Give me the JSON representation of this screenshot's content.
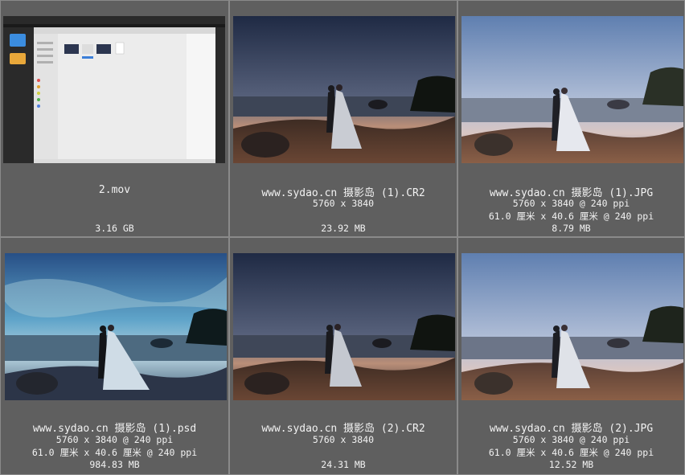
{
  "files": [
    {
      "name": "2.mov",
      "details": [],
      "size": "3.16 GB"
    },
    {
      "name": "www.sydao.cn 摄影岛 (1).CR2",
      "details": [
        "5760 x 3840"
      ],
      "size": "23.92 MB"
    },
    {
      "name": "www.sydao.cn 摄影岛 (1).JPG",
      "details": [
        "5760 x 3840 @ 240 ppi",
        "61.0 厘米 x 40.6 厘米 @ 240 ppi"
      ],
      "size": "8.79 MB"
    },
    {
      "name": "www.sydao.cn 摄影岛 (1).psd",
      "details": [
        "5760 x 3840 @ 240 ppi",
        "61.0 厘米 x 40.6 厘米 @ 240 ppi"
      ],
      "size": "984.83 MB"
    },
    {
      "name": "www.sydao.cn 摄影岛 (2).CR2",
      "details": [
        "5760 x 3840"
      ],
      "size": "24.31 MB"
    },
    {
      "name": "www.sydao.cn 摄影岛 (2).JPG",
      "details": [
        "5760 x 3840 @ 240 ppi",
        "61.0 厘米 x 40.6 厘米 @ 240 ppi"
      ],
      "size": "12.52 MB"
    }
  ]
}
